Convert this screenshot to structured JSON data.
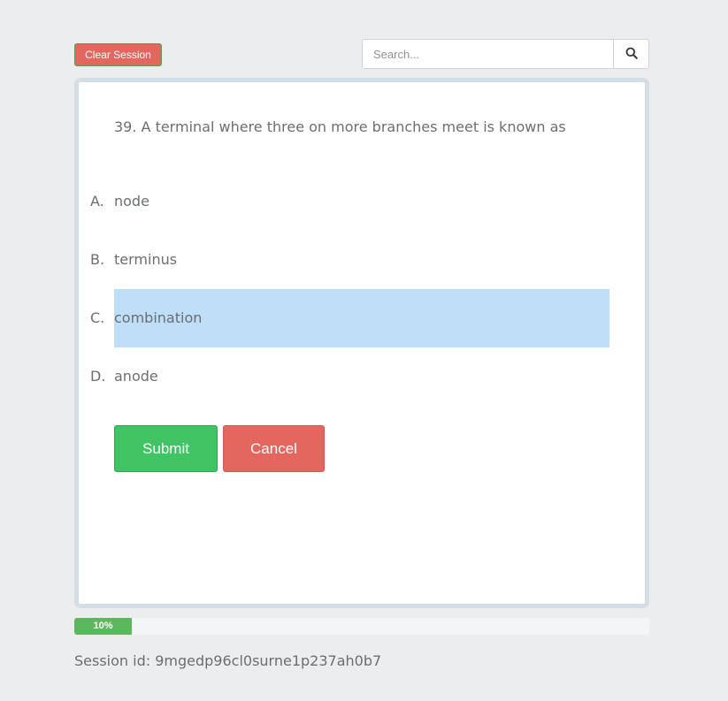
{
  "header": {
    "clear_session_label": "Clear Session",
    "search": {
      "placeholder": "Search...",
      "value": "",
      "button_icon": "search-icon"
    }
  },
  "question": {
    "number": 39,
    "text": "39. A terminal where three on more branches meet is known as",
    "options": [
      {
        "letter": "A.",
        "text": "node",
        "selected": false
      },
      {
        "letter": "B.",
        "text": "terminus",
        "selected": false
      },
      {
        "letter": "C.",
        "text": "combination",
        "selected": true
      },
      {
        "letter": "D.",
        "text": "anode",
        "selected": false
      }
    ]
  },
  "actions": {
    "submit_label": "Submit",
    "cancel_label": "Cancel"
  },
  "progress": {
    "label": "10%",
    "value_percent": 10
  },
  "session": {
    "text": "Session id: 9mgedp96cl0surne1p237ah0b7"
  },
  "colors": {
    "background": "#ecedee",
    "danger": "#e3675e",
    "success": "#40c464",
    "progress_fill": "#5cb85c",
    "selected_option": "#bfdff9",
    "card_border": "#d6dee5",
    "text": "#6b6e72"
  }
}
